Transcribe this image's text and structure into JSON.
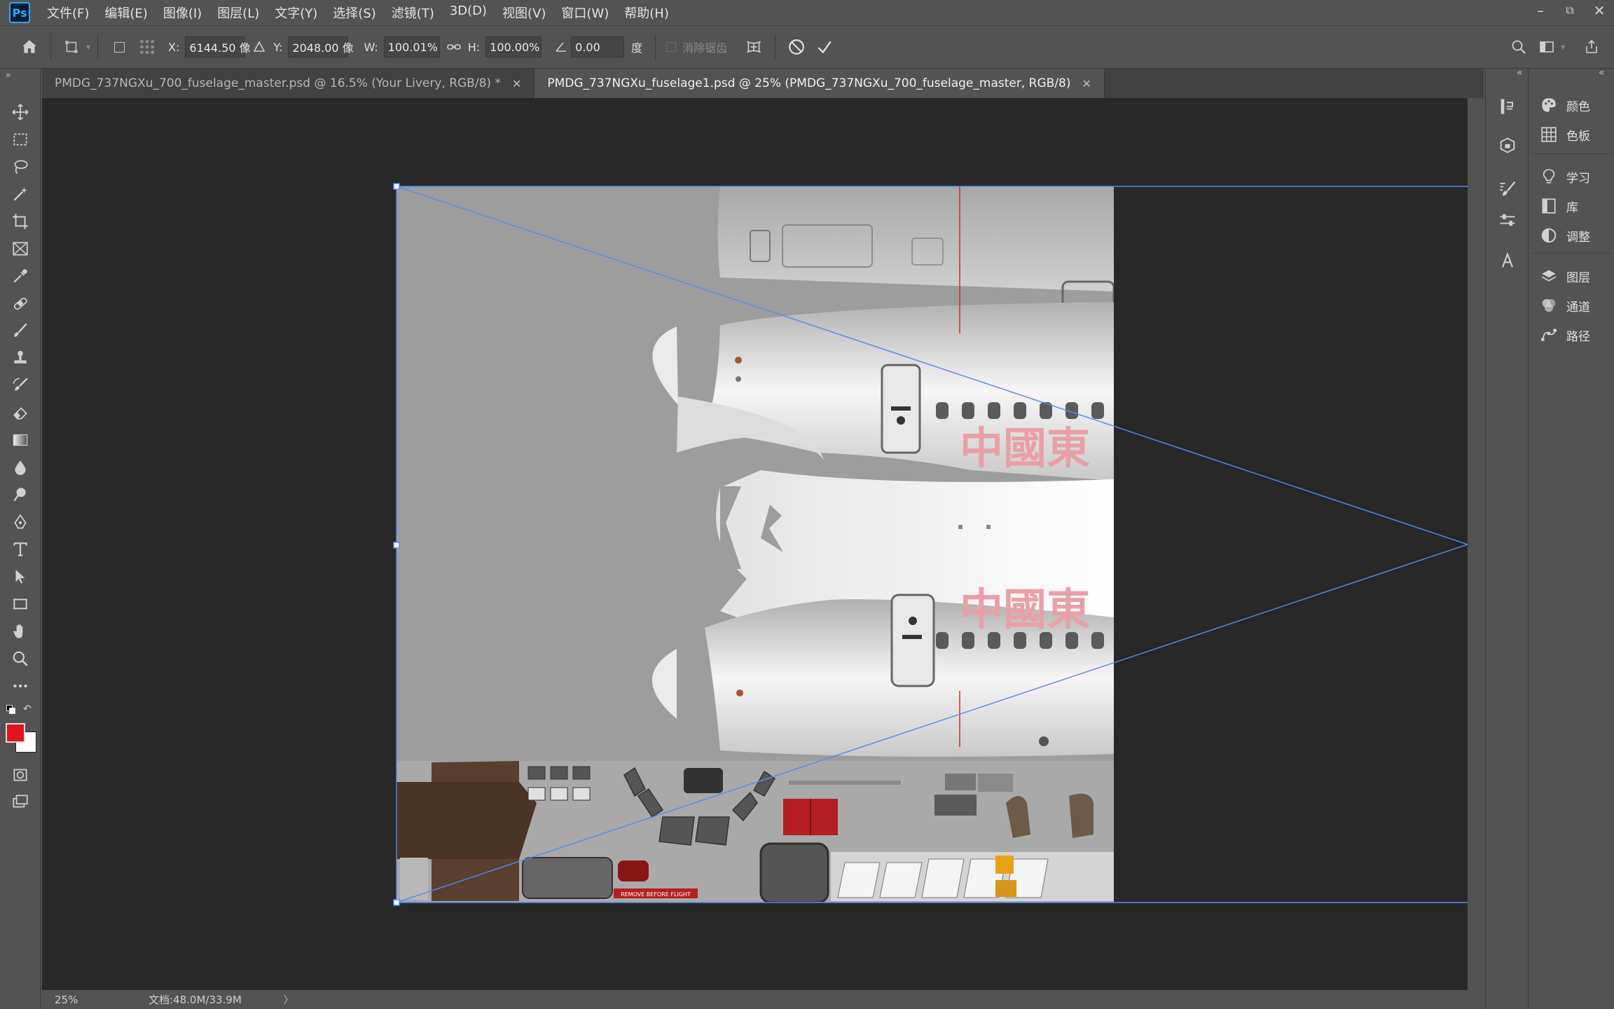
{
  "app": {
    "logo": "Ps"
  },
  "menus": [
    "文件(F)",
    "编辑(E)",
    "图像(I)",
    "图层(L)",
    "文字(Y)",
    "选择(S)",
    "滤镜(T)",
    "3D(D)",
    "视图(V)",
    "窗口(W)",
    "帮助(H)"
  ],
  "options": {
    "x_label": "X:",
    "x_value": "6144.50 像",
    "y_label": "Y:",
    "y_value": "2048.00 像",
    "w_label": "W:",
    "w_value": "100.01%",
    "h_label": "H:",
    "h_value": "100.00%",
    "angle_value": "0.00",
    "angle_unit": "度",
    "antialias_label": "消除锯齿"
  },
  "tabs": [
    {
      "title": "PMDG_737NGXu_700_fuselage_master.psd @ 16.5% (Your Livery, RGB/8) *",
      "active": false
    },
    {
      "title": "PMDG_737NGXu_fuselage1.psd @ 25% (PMDG_737NGXu_700_fuselage_master, RGB/8)",
      "active": true
    }
  ],
  "texture": {
    "airline_text": "中國東",
    "airline_text_cut": "中國東",
    "placard": "REMOVE BEFORE FLIGHT",
    "accent_color": "#e8a0a6"
  },
  "status": {
    "zoom": "25%",
    "doc": "文档:48.0M/33.9M"
  },
  "panels": [
    "颜色",
    "色板",
    "学习",
    "库",
    "调整",
    "图层",
    "通道",
    "路径"
  ],
  "colors": {
    "foreground": "#e0141e",
    "background": "#ffffff",
    "selection": "#4d8ef0"
  }
}
